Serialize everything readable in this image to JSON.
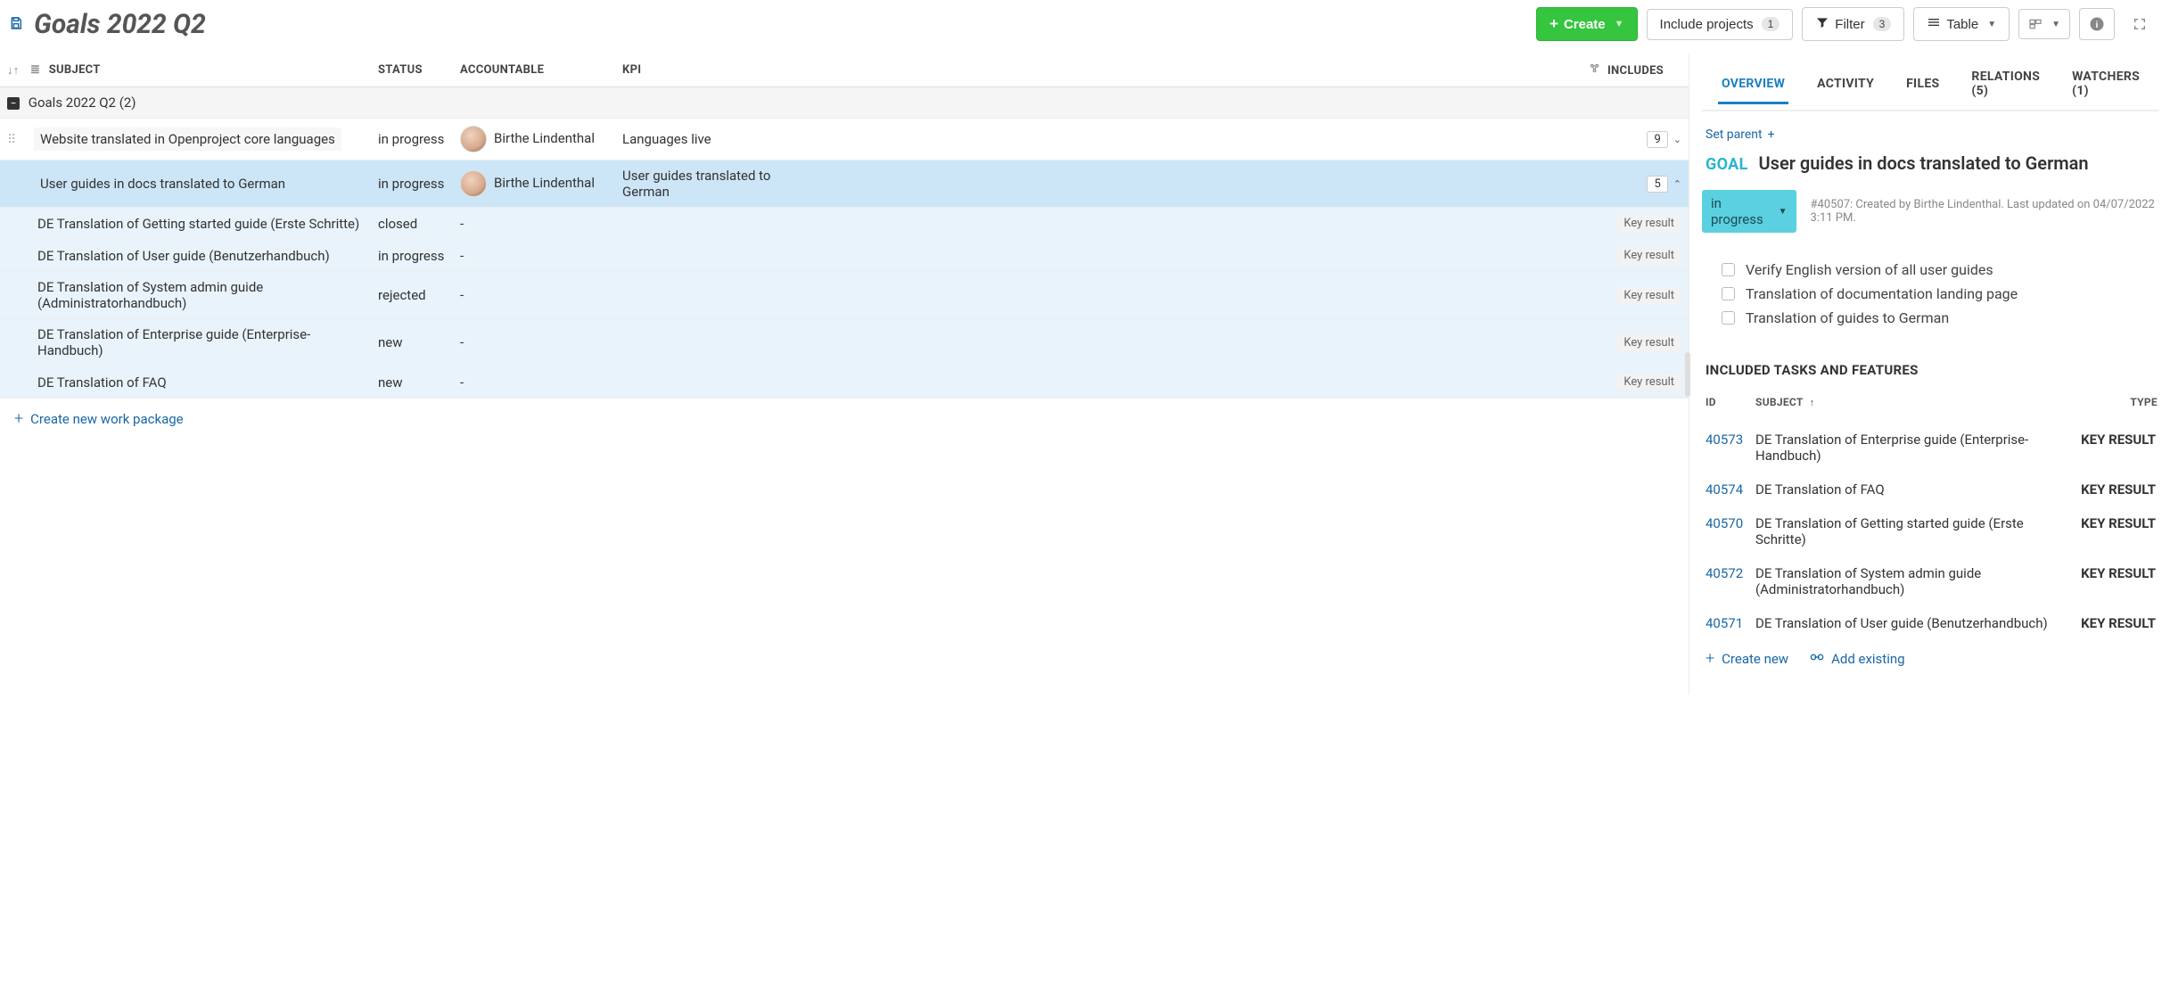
{
  "toolbar": {
    "title": "Goals 2022 Q2",
    "create_label": "Create",
    "include_projects_label": "Include projects",
    "include_projects_count": "1",
    "filter_label": "Filter",
    "filter_count": "3",
    "view_label": "Table"
  },
  "table": {
    "headers": {
      "subject": "SUBJECT",
      "status": "STATUS",
      "accountable": "ACCOUNTABLE",
      "kpi": "KPI",
      "includes": "INCLUDES"
    },
    "group": {
      "label": "Goals 2022 Q2",
      "count": "(2)"
    },
    "rows": [
      {
        "subject": "Website translated in Openproject core languages",
        "status": "in progress",
        "accountable": "Birthe Lindenthal",
        "has_avatar": true,
        "kpi": "Languages live",
        "includes_count": "9",
        "includes_open": false,
        "selected": false,
        "child": false,
        "indent": 1,
        "draggable": true
      },
      {
        "subject": "User guides in docs translated to German",
        "status": "in progress",
        "accountable": "Birthe Lindenthal",
        "has_avatar": true,
        "kpi": "User guides translated to German",
        "includes_count": "5",
        "includes_open": true,
        "selected": true,
        "child": false,
        "indent": 1,
        "draggable": false
      },
      {
        "subject": "DE Translation of Getting started guide (Erste Schritte)",
        "status": "closed",
        "accountable": "-",
        "kpi": "",
        "key_result": "Key result",
        "child": true,
        "indent": 2
      },
      {
        "subject": "DE Translation of User guide (Benutzerhandbuch)",
        "status": "in progress",
        "accountable": "-",
        "kpi": "",
        "key_result": "Key result",
        "child": true,
        "indent": 2
      },
      {
        "subject": "DE Translation of System admin guide (Administratorhandbuch)",
        "status": "rejected",
        "accountable": "-",
        "kpi": "",
        "key_result": "Key result",
        "child": true,
        "indent": 2
      },
      {
        "subject": "DE Translation of Enterprise guide (Enterprise-Handbuch)",
        "status": "new",
        "accountable": "-",
        "kpi": "",
        "key_result": "Key result",
        "child": true,
        "indent": 2
      },
      {
        "subject": "DE Translation of FAQ",
        "status": "new",
        "accountable": "-",
        "kpi": "",
        "key_result": "Key result",
        "child": true,
        "indent": 2
      }
    ],
    "create_new": "Create new work package"
  },
  "detail": {
    "tabs": {
      "overview": "OVERVIEW",
      "activity": "ACTIVITY",
      "files": "FILES",
      "relations": "RELATIONS (5)",
      "watchers": "WATCHERS (1)"
    },
    "set_parent": "Set parent",
    "type_label": "GOAL",
    "title": "User guides in docs translated to German",
    "status": "in progress",
    "meta": "#40507: Created by Birthe Lindenthal. Last updated on 04/07/2022 3:11 PM.",
    "checklist": [
      "Verify English version of all user guides",
      "Translation of documentation landing page",
      "Translation of guides to German"
    ],
    "included_title": "INCLUDED TASKS AND FEATURES",
    "inc_headers": {
      "id": "ID",
      "subject": "SUBJECT",
      "type": "TYPE"
    },
    "included": [
      {
        "id": "40573",
        "subject": "DE Translation of Enterprise guide (Enterprise-Handbuch)",
        "type": "KEY RESULT"
      },
      {
        "id": "40574",
        "subject": "DE Translation of FAQ",
        "type": "KEY RESULT"
      },
      {
        "id": "40570",
        "subject": "DE Translation of Getting started guide (Erste Schritte)",
        "type": "KEY RESULT"
      },
      {
        "id": "40572",
        "subject": "DE Translation of System admin guide (Administratorhandbuch)",
        "type": "KEY RESULT"
      },
      {
        "id": "40571",
        "subject": "DE Translation of User guide (Benutzerhandbuch)",
        "type": "KEY RESULT"
      }
    ],
    "create_new": "Create new",
    "add_existing": "Add existing"
  }
}
